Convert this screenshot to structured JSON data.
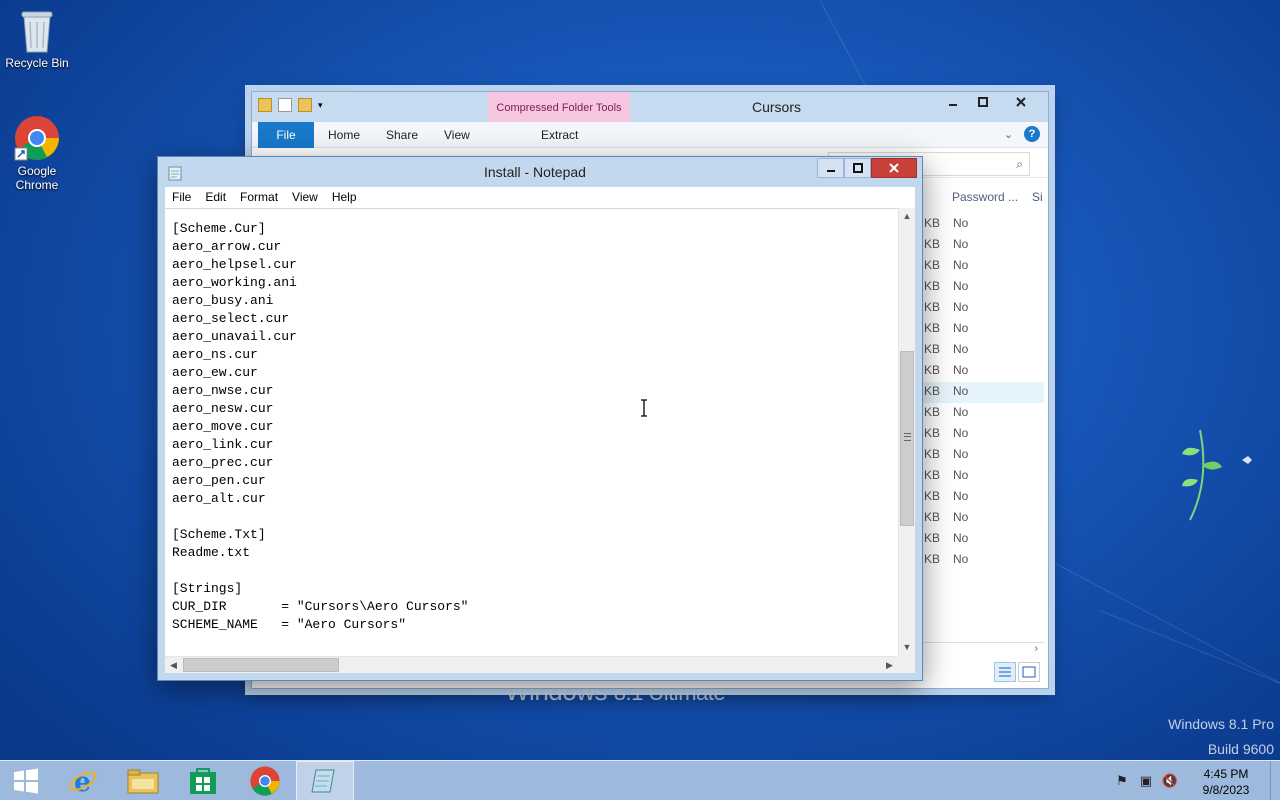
{
  "desktop": {
    "icons": [
      {
        "label": "Recycle Bin"
      },
      {
        "label": "Google Chrome"
      }
    ],
    "branding": {
      "word": "Windows",
      "version": "8.1 Ultimate"
    },
    "watermark": {
      "line1": "Windows 8.1 Pro",
      "line2": "Build 9600"
    }
  },
  "explorer": {
    "title": "Cursors",
    "context_tab": "Compressed Folder Tools",
    "ribbon_tabs": [
      "File",
      "Home",
      "Share",
      "View"
    ],
    "context_subtab": "Extract",
    "columns": {
      "password": "Password ...",
      "size": "Si"
    },
    "size_unit": "KB",
    "password_values": [
      "No",
      "No",
      "No",
      "No",
      "No",
      "No",
      "No",
      "No",
      "No",
      "No",
      "No",
      "No",
      "No",
      "No",
      "No",
      "No",
      "No"
    ]
  },
  "notepad": {
    "title": "Install - Notepad",
    "menu": [
      "File",
      "Edit",
      "Format",
      "View",
      "Help"
    ],
    "lines": [
      "",
      "[Scheme.Cur]",
      "aero_arrow.cur",
      "aero_helpsel.cur",
      "aero_working.ani",
      "aero_busy.ani",
      "aero_select.cur",
      "aero_unavail.cur",
      "aero_ns.cur",
      "aero_ew.cur",
      "aero_nwse.cur",
      "aero_nesw.cur",
      "aero_move.cur",
      "aero_link.cur",
      "aero_prec.cur",
      "aero_pen.cur",
      "aero_alt.cur",
      "",
      "[Scheme.Txt]",
      "Readme.txt",
      "",
      "[Strings]",
      "CUR_DIR       = \"Cursors\\Aero Cursors\"",
      "SCHEME_NAME   = \"Aero Cursors\""
    ]
  },
  "taskbar": {
    "items": [
      "internet-explorer",
      "file-explorer",
      "store",
      "chrome",
      "notepad"
    ],
    "clock": {
      "time": "4:45 PM",
      "date": "9/8/2023"
    }
  },
  "colors": {
    "accent": "#1979ca",
    "close_red": "#c7403a",
    "context_pink": "#f7c6e0"
  }
}
